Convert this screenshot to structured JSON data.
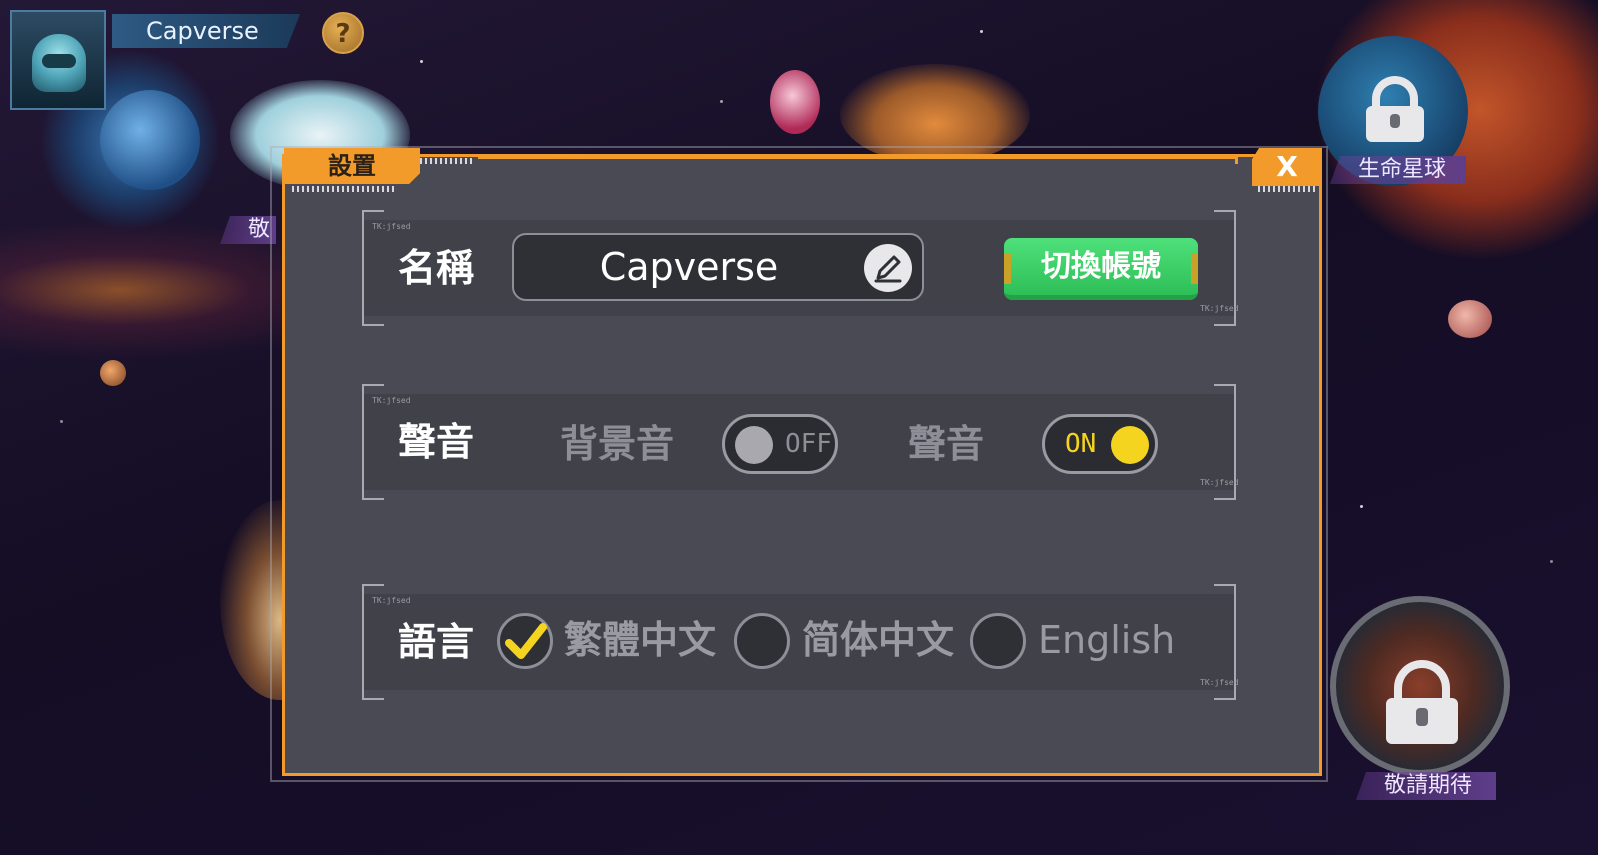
{
  "player": {
    "name": "Capverse",
    "help_symbol": "?"
  },
  "map": {
    "life_planet_label": "生命星球",
    "coming_soon_label": "敬請期待",
    "partial_label": "敬"
  },
  "settings": {
    "title": "設置",
    "close_label": "X",
    "name_row": {
      "label": "名稱",
      "value": "Capverse",
      "switch_account_label": "切換帳號"
    },
    "sound_row": {
      "label": "聲音",
      "bgm_label": "背景音",
      "bgm_state": "OFF",
      "sfx_label": "聲音",
      "sfx_state": "ON"
    },
    "language_row": {
      "label": "語言",
      "options": [
        {
          "label": "繁體中文",
          "selected": true
        },
        {
          "label": "简体中文",
          "selected": false
        },
        {
          "label": "English",
          "selected": false
        }
      ]
    },
    "row_tag": "TK:jfsed"
  },
  "colors": {
    "accent_orange": "#f29b2b",
    "panel_bg": "#4a4a54",
    "switch_green": "#3fd06a",
    "toggle_on_knob": "#f5d41f",
    "toggle_off_knob": "#a8a8ae",
    "check_yellow": "#f5d41f"
  },
  "icons": [
    "avatar-icon",
    "help-icon",
    "close-icon",
    "edit-pencil-icon",
    "checkmark-icon",
    "lock-icon"
  ]
}
